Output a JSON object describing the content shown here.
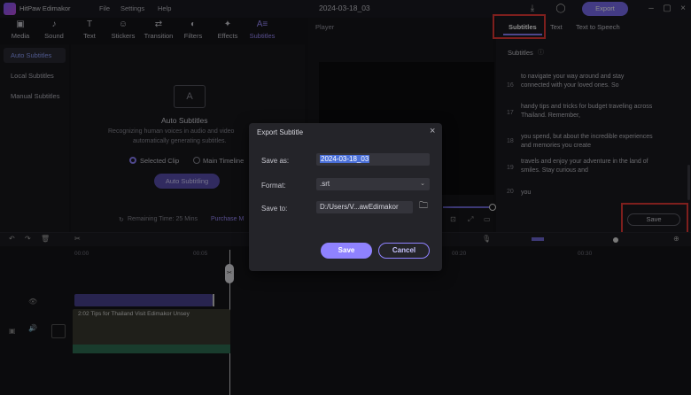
{
  "app": {
    "name": "HitPaw Edimakor",
    "menu": [
      "File",
      "Settings",
      "Help"
    ],
    "project_title": "2024-03-18_03",
    "export_label": "Export"
  },
  "toolbar": {
    "items": [
      {
        "label": "Media",
        "icon": "media-icon"
      },
      {
        "label": "Sound",
        "icon": "music-icon"
      },
      {
        "label": "Text",
        "icon": "text-icon"
      },
      {
        "label": "Stickers",
        "icon": "sticker-icon"
      },
      {
        "label": "Transition",
        "icon": "transition-icon"
      },
      {
        "label": "Filters",
        "icon": "filter-icon"
      },
      {
        "label": "Effects",
        "icon": "effects-icon"
      },
      {
        "label": "Subtitles",
        "icon": "subtitles-icon"
      }
    ]
  },
  "left_nav": {
    "items": [
      "Auto Subtitles",
      "Local Subtitles",
      "Manual Subtitles"
    ]
  },
  "auto_panel": {
    "title": "Auto Subtitles",
    "desc1": "Recognizing human voices in audio and video",
    "desc2": "automatically generating subtitles.",
    "opt_selected_clip": "Selected Clip",
    "opt_main_timeline": "Main Timeline",
    "button": "Auto Subtitling",
    "remaining": "Remaining Time: 25 Mins",
    "purchase": "Purchase M"
  },
  "player": {
    "label": "Player"
  },
  "right_panel": {
    "tabs": [
      "Subtitles",
      "Text",
      "Text to Speech"
    ],
    "header": "Subtitles",
    "lines": [
      {
        "num": "",
        "text": "to navigate your way around and stay connected with your loved ones. So"
      },
      {
        "num": "16",
        "text": ""
      },
      {
        "num": "17",
        "text": "handy tips and tricks for budget traveling across Thailand. Remember,"
      },
      {
        "num": "18",
        "text": "you spend, but about the incredible experiences and memories you create"
      },
      {
        "num": "19",
        "text": "travels and enjoy your adventure in the land of smiles. Stay curious and"
      },
      {
        "num": "20",
        "text": "you"
      }
    ],
    "save_label": "Save"
  },
  "timeline": {
    "ticks": [
      "00:00",
      "00:05",
      "00:10",
      "00:15",
      "00:20",
      "00:25",
      "00:30"
    ],
    "clip_title": "2:02 Tips for Thailand Visit Edimakor Unsey"
  },
  "dialog": {
    "title": "Export Subtitle",
    "save_as_label": "Save as:",
    "save_as_value": "2024-03-18_03",
    "format_label": "Format:",
    "format_value": ".srt",
    "save_to_label": "Save to:",
    "save_to_value": "D:/Users/V...awEdimakor",
    "save_button": "Save",
    "cancel_button": "Cancel"
  }
}
